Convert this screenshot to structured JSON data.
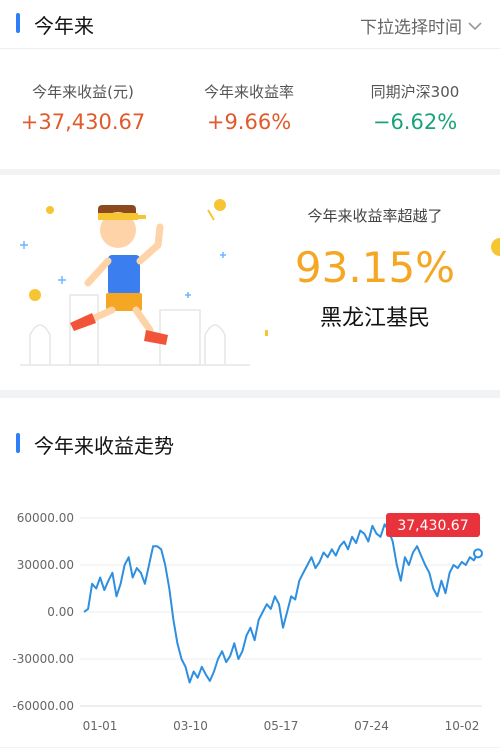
{
  "header": {
    "title": "今年来",
    "select_label": "下拉选择时间"
  },
  "stats": [
    {
      "label": "今年来收益(元)",
      "value": "+37,430.67",
      "color": "#e05a2b"
    },
    {
      "label": "今年来收益率",
      "value": "+9.66%",
      "color": "#e05a2b"
    },
    {
      "label": "同期沪深300",
      "value": "−6.62%",
      "color": "#1aa37a"
    }
  ],
  "rank": {
    "caption": "今年来收益率超越了",
    "percent": "93.15%",
    "who": "黑龙江基民"
  },
  "trend": {
    "title": "今年来收益走势",
    "current_label": "37,430.67"
  },
  "colors": {
    "accent": "#2d7ef7",
    "line": "#2e8fe0",
    "tag": "#e8323c"
  },
  "chart_data": {
    "type": "line",
    "x_ticks": [
      "01-01",
      "03-10",
      "05-17",
      "07-24",
      "10-02"
    ],
    "y_ticks": [
      "60000.00",
      "30000.00",
      "0.00",
      "-30000.00",
      "-60000.00"
    ],
    "ylim": [
      -60000,
      60000
    ],
    "grid": true,
    "series": [
      {
        "values": [
          0,
          2000,
          18000,
          15000,
          22000,
          14000,
          20000,
          25000,
          10000,
          18000,
          30000,
          35000,
          22000,
          28000,
          25000,
          18000,
          30000,
          42000,
          42000,
          40000,
          30000,
          15000,
          -5000,
          -20000,
          -30000,
          -35000,
          -45000,
          -38000,
          -42000,
          -35000,
          -40000,
          -44000,
          -38000,
          -30000,
          -25000,
          -32000,
          -28000,
          -20000,
          -30000,
          -25000,
          -15000,
          -10000,
          -18000,
          -5000,
          0,
          5000,
          2000,
          10000,
          5000,
          -10000,
          0,
          10000,
          8000,
          20000,
          25000,
          30000,
          35000,
          28000,
          32000,
          38000,
          35000,
          40000,
          36000,
          42000,
          45000,
          40000,
          48000,
          44000,
          52000,
          50000,
          45000,
          55000,
          50000,
          48000,
          56000,
          52000,
          45000,
          30000,
          20000,
          35000,
          30000,
          38000,
          42000,
          36000,
          30000,
          25000,
          15000,
          10000,
          20000,
          12000,
          25000,
          30000,
          28000,
          32000,
          30000,
          35000,
          33000,
          37430
        ]
      }
    ]
  }
}
